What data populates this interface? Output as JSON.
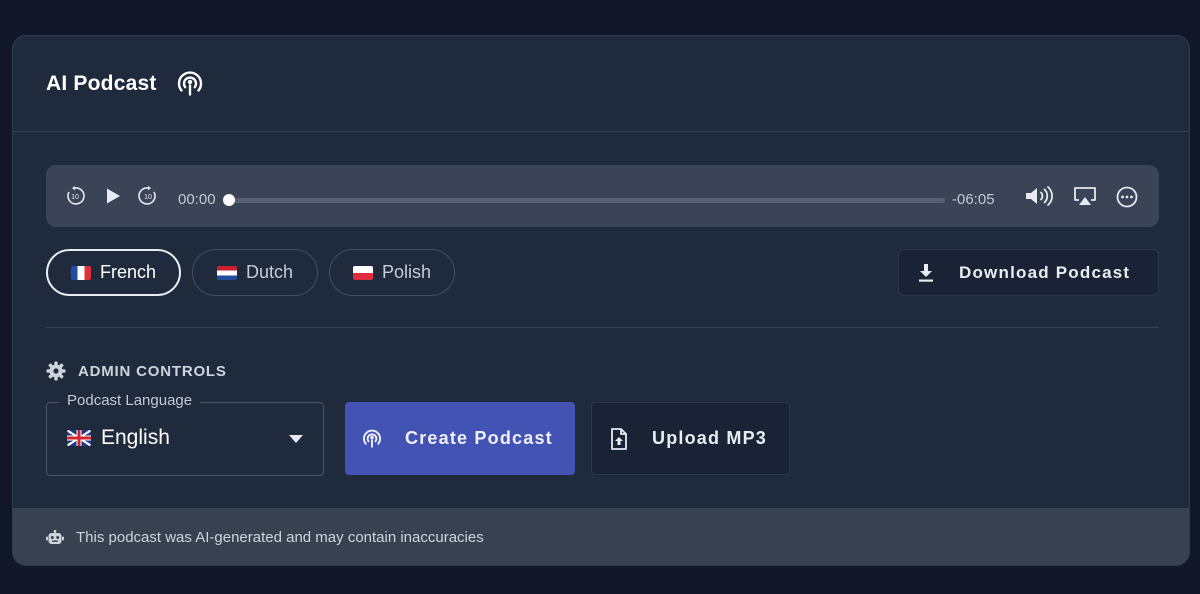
{
  "header": {
    "title": "AI Podcast",
    "icon": "podcast-icon"
  },
  "player": {
    "current_time": "00:00",
    "remaining_time": "-06:05",
    "progress": 0,
    "icons": [
      "rewind-10-icon",
      "play-icon",
      "forward-10-icon",
      "volume-icon",
      "airplay-icon",
      "more-options-icon"
    ]
  },
  "languages": [
    {
      "label": "French",
      "flag": "flag-fr",
      "active": true
    },
    {
      "label": "Dutch",
      "flag": "flag-nl",
      "active": false
    },
    {
      "label": "Polish",
      "flag": "flag-pl",
      "active": false
    }
  ],
  "download": {
    "label": "Download Podcast",
    "icon": "download-icon"
  },
  "admin": {
    "title": "ADMIN CONTROLS",
    "icon": "gear-icon",
    "language_select": {
      "legend": "Podcast Language",
      "value": "English",
      "flag": "flag-gb"
    },
    "create_label": "Create Podcast",
    "upload_label": "Upload MP3"
  },
  "footer": {
    "text": "This podcast was AI-generated and may contain inaccuracies",
    "icon": "robot-icon"
  },
  "colors": {
    "page_bg": "#111729",
    "card_bg": "#1f2a3d",
    "player_bg": "#3a4456",
    "accent": "#4353b4",
    "footer_bg": "#37414f"
  }
}
